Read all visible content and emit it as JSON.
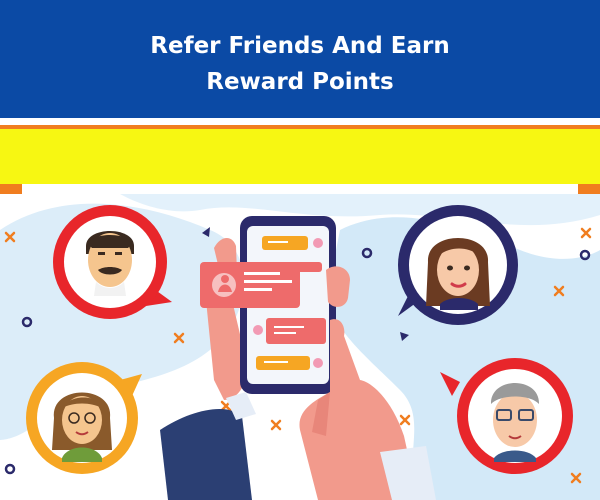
{
  "banner": {
    "title_line1": "Refer Friends And Earn",
    "title_line2": "Reward Points"
  },
  "colors": {
    "header_blue": "#0b4aa5",
    "yellow_band": "#f7f712",
    "accent_orange": "#f07d1f",
    "avatar_red": "#e8262b",
    "avatar_navy": "#2b2a6b",
    "chat_red": "#ee6b6b",
    "chat_orange": "#f6a623",
    "background_blob": "#cfe6f7"
  },
  "illustration": {
    "phone": "smartphone-with-chat",
    "avatars": [
      "man-mustache-avatar",
      "woman-long-hair-avatar",
      "woman-glasses-avatar",
      "older-man-glasses-avatar"
    ]
  }
}
